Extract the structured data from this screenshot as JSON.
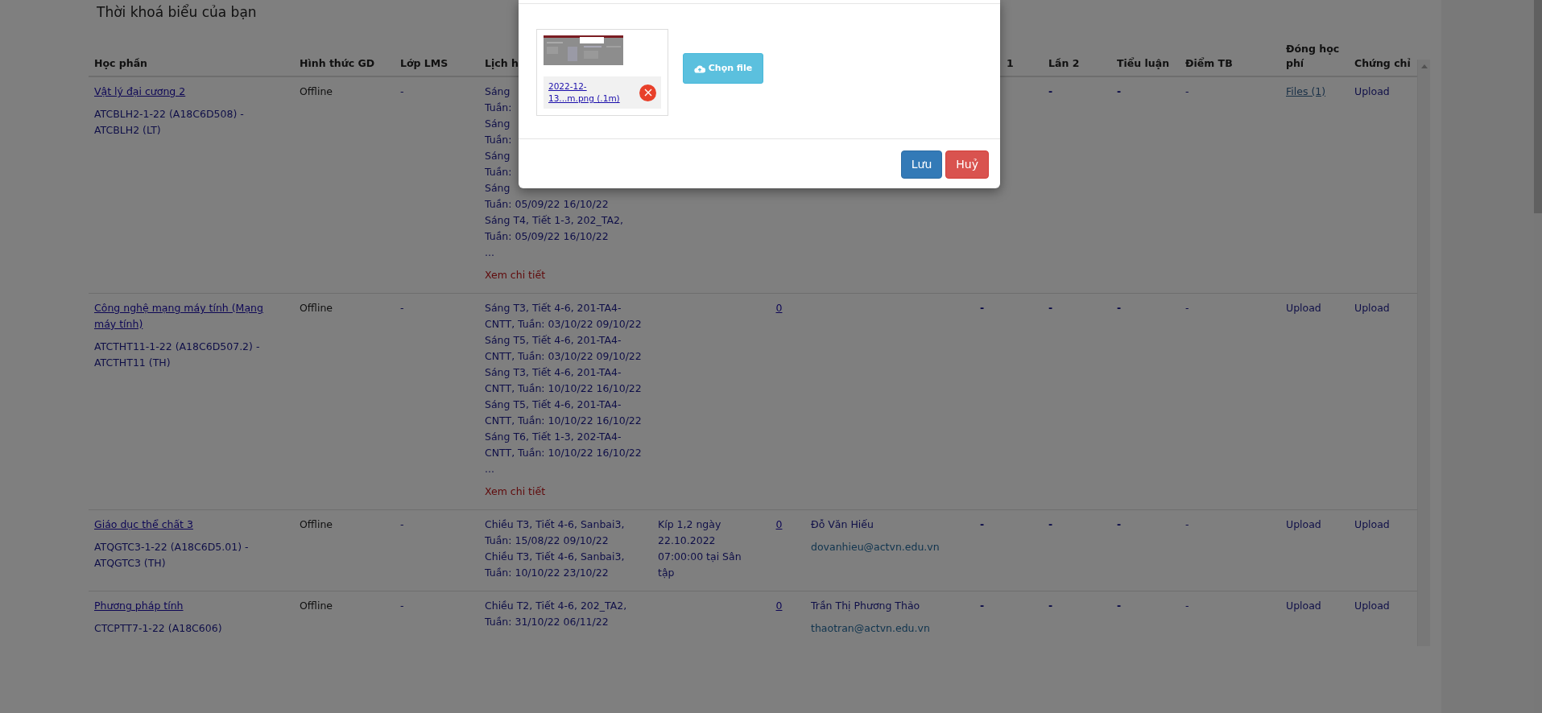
{
  "page_title": "Thời khoá biểu của bạn",
  "columns": [
    {
      "label": "Học phần"
    },
    {
      "label": "Hình thức GD"
    },
    {
      "label": "Lớp LMS"
    },
    {
      "label": "Lịch h"
    },
    {},
    {},
    {},
    {
      "label": "1"
    },
    {
      "label": "Lần 2"
    },
    {
      "label": "Tiểu luận"
    },
    {
      "label": "Điểm TB"
    },
    {
      "label": "Đóng học phí"
    },
    {
      "label": "Chứng chỉ"
    }
  ],
  "rows": [
    {
      "course": "Vật lý đại cương 2",
      "code": "ATCBLH2-1-22 (A18C6D508) - ATCBLH2 (LT)",
      "mode": "Offline",
      "lms": "-",
      "schedule": [
        "Sáng",
        "Tuần:",
        "Sáng",
        "Tuần:",
        "Sáng",
        "Tuần:",
        "Sáng",
        "Tuần: 05/09/22 16/10/22",
        "Sáng T4, Tiết 1-3, 202_TA2,",
        "Tuần: 05/09/22 16/10/22"
      ],
      "more": "...",
      "detail": "Xem chi tiết",
      "lan2": "-",
      "essay": "-",
      "avg": "-",
      "fee": {
        "text": "Files (1)",
        "kind": "files"
      },
      "cert": "Upload"
    },
    {
      "course": "Công nghệ mạng máy tính (Mạng máy tính)",
      "code": "ATCTHT11-1-22 (A18C6D507.2) - ATCTHT11 (TH)",
      "mode": "Offline",
      "lms": "-",
      "schedule": [
        "Sáng T3, Tiết 4-6, 201-TA4-CNTT, Tuần: 03/10/22 09/10/22",
        "Sáng T5, Tiết 4-6, 201-TA4-CNTT, Tuần: 03/10/22 09/10/22",
        "Sáng T3, Tiết 4-6, 201-TA4-CNTT, Tuần: 10/10/22 16/10/22",
        "Sáng T5, Tiết 4-6, 201-TA4-CNTT, Tuần: 10/10/22 16/10/22",
        "Sáng T6, Tiết 1-3, 202-TA4-CNTT, Tuần: 10/10/22 16/10/22"
      ],
      "more": "...",
      "detail": "Xem chi tiết",
      "count": "0",
      "lan1": "-",
      "lan2": "-",
      "essay": "-",
      "avg": "-",
      "fee": {
        "text": "Upload",
        "kind": "upload"
      },
      "cert": "Upload"
    },
    {
      "course": "Giáo dục thể chất 3",
      "code": "ATQGTC3-1-22 (A18C6D5.01) - ATQGTC3 (TH)",
      "mode": "Offline",
      "lms": "-",
      "schedule": [
        "Chiều T3, Tiết 4-6, Sanbai3, Tuần: 15/08/22 09/10/22",
        "Chiều T3, Tiết 4-6, Sanbai3, Tuần: 10/10/22 23/10/22"
      ],
      "exam": "Kíp 1,2 ngày 22.10.2022 07:00:00 tại Sân tập",
      "count": "0",
      "teacher": "Đỗ Văn Hiếu",
      "email": "dovanhieu@actvn.edu.vn",
      "lan1": "-",
      "lan2": "-",
      "essay": "-",
      "avg": "-",
      "fee": {
        "text": "Upload",
        "kind": "upload"
      },
      "cert": "Upload"
    },
    {
      "course": "Phương pháp tính",
      "code": "CTCPTT7-1-22 (A18C606)",
      "mode": "Offline",
      "lms": "-",
      "schedule": [
        "Chiều T2, Tiết 4-6, 202_TA2, Tuần: 31/10/22 06/11/22"
      ],
      "count": "0",
      "teacher": "Trần Thị Phương Thảo",
      "email": "thaotran@actvn.edu.vn",
      "lan1": "-",
      "lan2": "-",
      "essay": "-",
      "avg": "-",
      "fee": {
        "text": "Upload",
        "kind": "upload"
      },
      "cert": "Upload"
    }
  ],
  "modal": {
    "file_name": "2022-12-13...m.png (.1m)",
    "choose_button": "Chọn file",
    "buttons": [
      {
        "label": "Lưu",
        "kind": "primary"
      },
      {
        "label": "Huỷ",
        "kind": "danger"
      }
    ]
  }
}
